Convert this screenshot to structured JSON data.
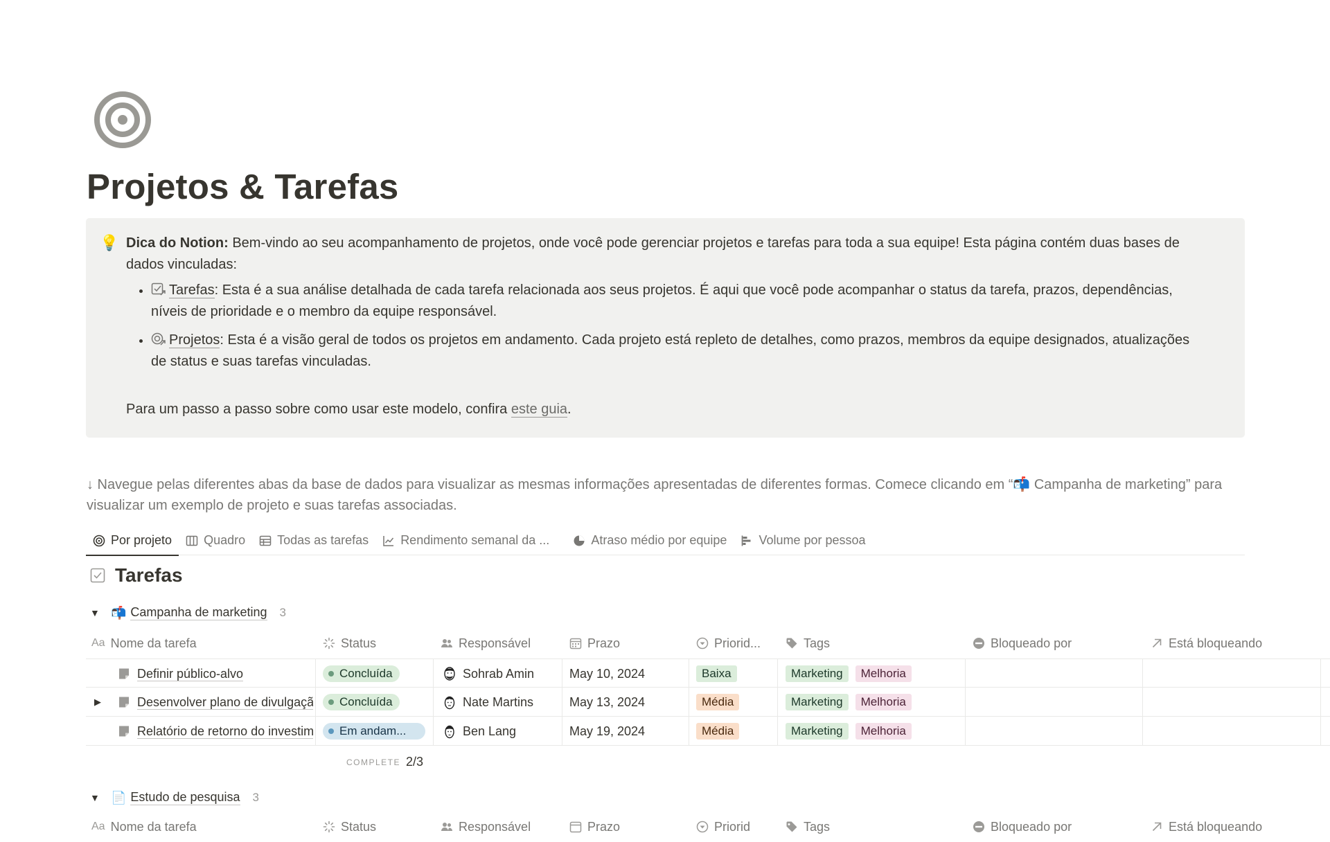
{
  "page": {
    "icon": "target-icon",
    "title": "Projetos & Tarefas"
  },
  "callout": {
    "icon": "lightbulb-icon",
    "tip_label": "Dica do Notion:",
    "tip_text": " Bem-vindo ao seu acompanhamento de projetos, onde você pode gerenciar projetos e tarefas para toda a sua equipe! Esta página contém duas bases de dados vinculadas:",
    "bullets": [
      {
        "icon": "task-check-icon",
        "link": "Tarefas",
        "text": ": Esta é a sua análise detalhada de cada tarefa relacionada aos seus projetos. É aqui que você pode acompanhar o status da tarefa, prazos, dependências, níveis de prioridade e o membro da equipe responsável."
      },
      {
        "icon": "target-arrow-icon",
        "link": "Projetos",
        "text": ": Esta é a visão geral de todos os projetos em andamento. Cada projeto está repleto de detalhes, como prazos, membros da equipe designados, atualizações de status e suas tarefas vinculadas."
      }
    ],
    "guide_prefix": "Para um passo a passo sobre como usar este modelo, confira ",
    "guide_link": "este guia",
    "guide_suffix": "."
  },
  "nav_hint": "↓ Navegue pelas diferentes abas da base de dados para visualizar as mesmas informações apresentadas de diferentes formas. Comece clicando em “📬  Campanha de marketing” para visualizar um exemplo de projeto e suas tarefas associadas.",
  "tabs": [
    {
      "label": "Por projeto",
      "icon": "target-icon",
      "active": true
    },
    {
      "label": "Quadro",
      "icon": "board-icon",
      "active": false
    },
    {
      "label": "Todas as tarefas",
      "icon": "table-icon",
      "active": false
    },
    {
      "label": "Rendimento semanal da ...",
      "icon": "line-chart-icon",
      "active": false
    },
    {
      "label": "Atraso médio por equipe",
      "icon": "pie-chart-icon",
      "active": false
    },
    {
      "label": "Volume por pessoa",
      "icon": "bar-chart-icon",
      "active": false
    }
  ],
  "database": {
    "icon": "checkbox-icon",
    "title": "Tarefas"
  },
  "columns": {
    "name": "Nome da tarefa",
    "name_prefix": "Aa",
    "status": "Status",
    "assignee": "Responsável",
    "due": "Prazo",
    "priority": "Priorid...",
    "tags": "Tags",
    "blocked_by": "Bloqueado por",
    "blocking": "Está bloqueando"
  },
  "columns_group2": {
    "priority": "Priorid"
  },
  "groups": [
    {
      "icon": "📬",
      "name": "Campanha de marketing",
      "count": "3",
      "rows": [
        {
          "name": "Definir público-alvo",
          "expandable": false,
          "status": "Concluída",
          "assignee": "Sohrab Amin",
          "due": "May 10, 2024",
          "priority": "Baixa",
          "tags": [
            "Marketing",
            "Melhoria"
          ]
        },
        {
          "name": "Desenvolver plano de divulgação",
          "expandable": true,
          "status": "Concluída",
          "assignee": "Nate Martins",
          "due": "May 13, 2024",
          "priority": "Média",
          "tags": [
            "Marketing",
            "Melhoria"
          ]
        },
        {
          "name": "Relatório de retorno do investimento",
          "expandable": false,
          "status": "Em andam...",
          "assignee": "Ben Lang",
          "due": "May 19, 2024",
          "priority": "Média",
          "tags": [
            "Marketing",
            "Melhoria"
          ]
        }
      ],
      "complete_label": "COMPLETE",
      "complete_value": "2/3"
    },
    {
      "icon": "📄",
      "name": "Estudo de pesquisa",
      "count": "3"
    }
  ],
  "colors": {
    "status_done_bg": "#dbeddb",
    "status_done_dot": "#6c9b7d",
    "status_progress_bg": "#d3e5ef",
    "status_progress_dot": "#5b97bd",
    "priority_low_bg": "#dbeddb",
    "priority_medium_bg": "#fadec9",
    "tag_marketing_bg": "#dbeddb",
    "tag_improvement_bg": "#f5e0e9"
  }
}
